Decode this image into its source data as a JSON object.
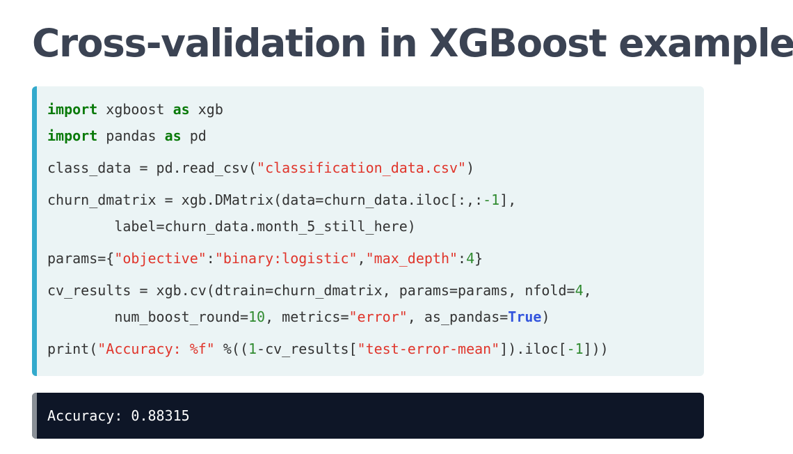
{
  "page": {
    "title": "Cross-validation in XGBoost example"
  },
  "code": {
    "lines": [
      [
        {
          "t": "import",
          "c": "kw"
        },
        {
          "t": " xgboost ",
          "c": ""
        },
        {
          "t": "as",
          "c": "kw"
        },
        {
          "t": " xgb",
          "c": ""
        }
      ],
      [
        {
          "t": "import",
          "c": "kw"
        },
        {
          "t": " pandas ",
          "c": ""
        },
        {
          "t": "as",
          "c": "kw"
        },
        {
          "t": " pd",
          "c": ""
        }
      ],
      [
        {
          "t": "class_data = pd.read_csv(",
          "c": ""
        },
        {
          "t": "\"classification_data.csv\"",
          "c": "str"
        },
        {
          "t": ")",
          "c": ""
        }
      ],
      [
        {
          "t": "churn_dmatrix = xgb.DMatrix(data=churn_data.iloc[:,:",
          "c": ""
        },
        {
          "t": "-1",
          "c": "num"
        },
        {
          "t": "],",
          "c": ""
        }
      ],
      [
        {
          "t": "        label=churn_data.month_5_still_here)",
          "c": ""
        }
      ],
      [
        {
          "t": "params={",
          "c": ""
        },
        {
          "t": "\"objective\"",
          "c": "str"
        },
        {
          "t": ":",
          "c": ""
        },
        {
          "t": "\"binary:logistic\"",
          "c": "str"
        },
        {
          "t": ",",
          "c": ""
        },
        {
          "t": "\"max_depth\"",
          "c": "str"
        },
        {
          "t": ":",
          "c": ""
        },
        {
          "t": "4",
          "c": "num"
        },
        {
          "t": "}",
          "c": ""
        }
      ],
      [
        {
          "t": "cv_results = xgb.cv(dtrain=churn_dmatrix, params=params, nfold=",
          "c": ""
        },
        {
          "t": "4",
          "c": "num"
        },
        {
          "t": ",",
          "c": ""
        }
      ],
      [
        {
          "t": "        num_boost_round=",
          "c": ""
        },
        {
          "t": "10",
          "c": "num"
        },
        {
          "t": ", metrics=",
          "c": ""
        },
        {
          "t": "\"error\"",
          "c": "str"
        },
        {
          "t": ", as_pandas=",
          "c": ""
        },
        {
          "t": "True",
          "c": "bool"
        },
        {
          "t": ")",
          "c": ""
        }
      ],
      [
        {
          "t": "print(",
          "c": ""
        },
        {
          "t": "\"Accuracy: %f\"",
          "c": "str"
        },
        {
          "t": " %((",
          "c": ""
        },
        {
          "t": "1",
          "c": "num"
        },
        {
          "t": "-cv_results[",
          "c": ""
        },
        {
          "t": "\"test-error-mean\"",
          "c": "str"
        },
        {
          "t": "]).iloc[",
          "c": ""
        },
        {
          "t": "-1",
          "c": "num"
        },
        {
          "t": "]))",
          "c": ""
        }
      ]
    ]
  },
  "output": {
    "text": "Accuracy: 0.88315"
  },
  "colors": {
    "title": "#3b4353",
    "code_background": "#ebf4f5",
    "code_accent": "#33aacc",
    "keyword": "#0a7a0a",
    "string": "#e0352b",
    "number": "#2f8a2f",
    "boolean": "#3355dd",
    "output_background": "#0e1627",
    "output_accent": "#8a9097"
  }
}
